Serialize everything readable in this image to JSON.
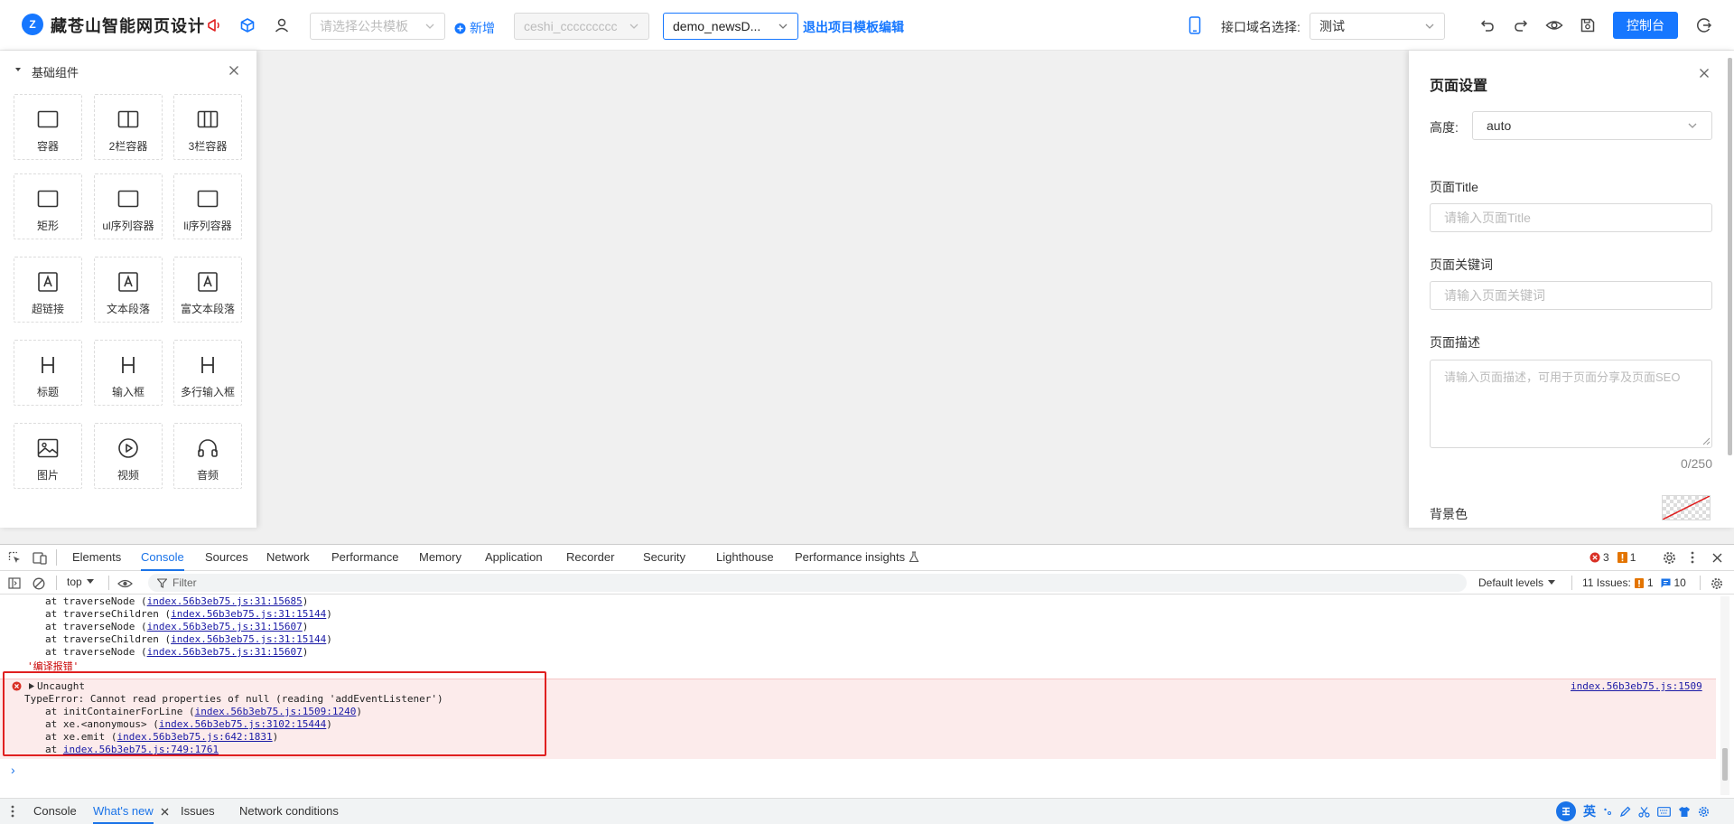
{
  "header": {
    "logo_text": "Z",
    "app_title": "藏苍山智能网页设计",
    "public_template_placeholder": "请选择公共模板",
    "add_label": "新增",
    "project_select": "ceshi_ccccccccc",
    "page_select": "demo_newsD...",
    "exit_edit_label": "退出项目模板编辑",
    "domain_label": "接口域名选择:",
    "domain_value": "测试",
    "console_button": "控制台"
  },
  "left_panel": {
    "section_title": "基础组件",
    "components": [
      {
        "label": "容器",
        "icon": "container-icon"
      },
      {
        "label": "2栏容器",
        "icon": "two-column-icon"
      },
      {
        "label": "3栏容器",
        "icon": "three-column-icon"
      },
      {
        "label": "矩形",
        "icon": "rectangle-icon"
      },
      {
        "label": "ul序列容器",
        "icon": "ul-list-icon"
      },
      {
        "label": "li序列容器",
        "icon": "li-list-icon"
      },
      {
        "label": "超链接",
        "icon": "link-text-icon"
      },
      {
        "label": "文本段落",
        "icon": "text-paragraph-icon"
      },
      {
        "label": "富文本段落",
        "icon": "rich-text-icon"
      },
      {
        "label": "标题",
        "icon": "heading-icon"
      },
      {
        "label": "输入框",
        "icon": "input-icon"
      },
      {
        "label": "多行输入框",
        "icon": "textarea-icon"
      },
      {
        "label": "图片",
        "icon": "image-icon"
      },
      {
        "label": "视频",
        "icon": "video-icon"
      },
      {
        "label": "音频",
        "icon": "audio-icon"
      }
    ]
  },
  "right_panel": {
    "title": "页面设置",
    "height_label": "高度:",
    "height_value": "auto",
    "page_title_label": "页面Title",
    "page_title_placeholder": "请输入页面Title",
    "keywords_label": "页面关键词",
    "keywords_placeholder": "请输入页面关键词",
    "description_label": "页面描述",
    "description_placeholder": "请输入页面描述，可用于页面分享及页面SEO",
    "description_counter": "0/250",
    "bg_color_label": "背景色"
  },
  "devtools": {
    "tabs": [
      "Elements",
      "Console",
      "Sources",
      "Network",
      "Performance",
      "Memory",
      "Application",
      "Recorder",
      "Security",
      "Lighthouse",
      "Performance insights"
    ],
    "active_tab": "Console",
    "error_count": "3",
    "warning_count": "1",
    "context": "top",
    "filter_placeholder": "Filter",
    "levels": "Default levels",
    "issues_label": "11 Issues:",
    "issues_warn": "1",
    "issues_info": "10",
    "stack_lines": [
      {
        "prefix": "at traverseNode (",
        "link": "index.56b3eb75.js:31:15685",
        "suffix": ")"
      },
      {
        "prefix": "at traverseChildren (",
        "link": "index.56b3eb75.js:31:15144",
        "suffix": ")"
      },
      {
        "prefix": "at traverseNode (",
        "link": "index.56b3eb75.js:31:15607",
        "suffix": ")"
      },
      {
        "prefix": "at traverseChildren (",
        "link": "index.56b3eb75.js:31:15144",
        "suffix": ")"
      },
      {
        "prefix": "at traverseNode (",
        "link": "index.56b3eb75.js:31:15607",
        "suffix": ")"
      }
    ],
    "string_log": "'编译报错'",
    "error": {
      "header": "Uncaught",
      "message": "TypeError: Cannot read properties of null (reading 'addEventListener')",
      "source_link": "index.56b3eb75.js:1509",
      "lines": [
        {
          "prefix": "at initContainerForLine (",
          "link": "index.56b3eb75.js:1509:1240",
          "suffix": ")"
        },
        {
          "prefix": "at xe.<anonymous> (",
          "link": "index.56b3eb75.js:3102:15444",
          "suffix": ")"
        },
        {
          "prefix": "at xe.emit (",
          "link": "index.56b3eb75.js:642:1831",
          "suffix": ")"
        },
        {
          "prefix": "at ",
          "link": "index.56b3eb75.js:749:1761",
          "suffix": ""
        }
      ]
    },
    "prompt": "›",
    "drawer_tabs": [
      "Console",
      "What's new",
      "Issues",
      "Network conditions"
    ],
    "drawer_active": "What's new",
    "ime_label": "英"
  },
  "colors": {
    "primary": "#1677ff",
    "devtools_accent": "#1a73e8",
    "error_bg": "#fcebeb",
    "highlight_box": "#e02020"
  }
}
